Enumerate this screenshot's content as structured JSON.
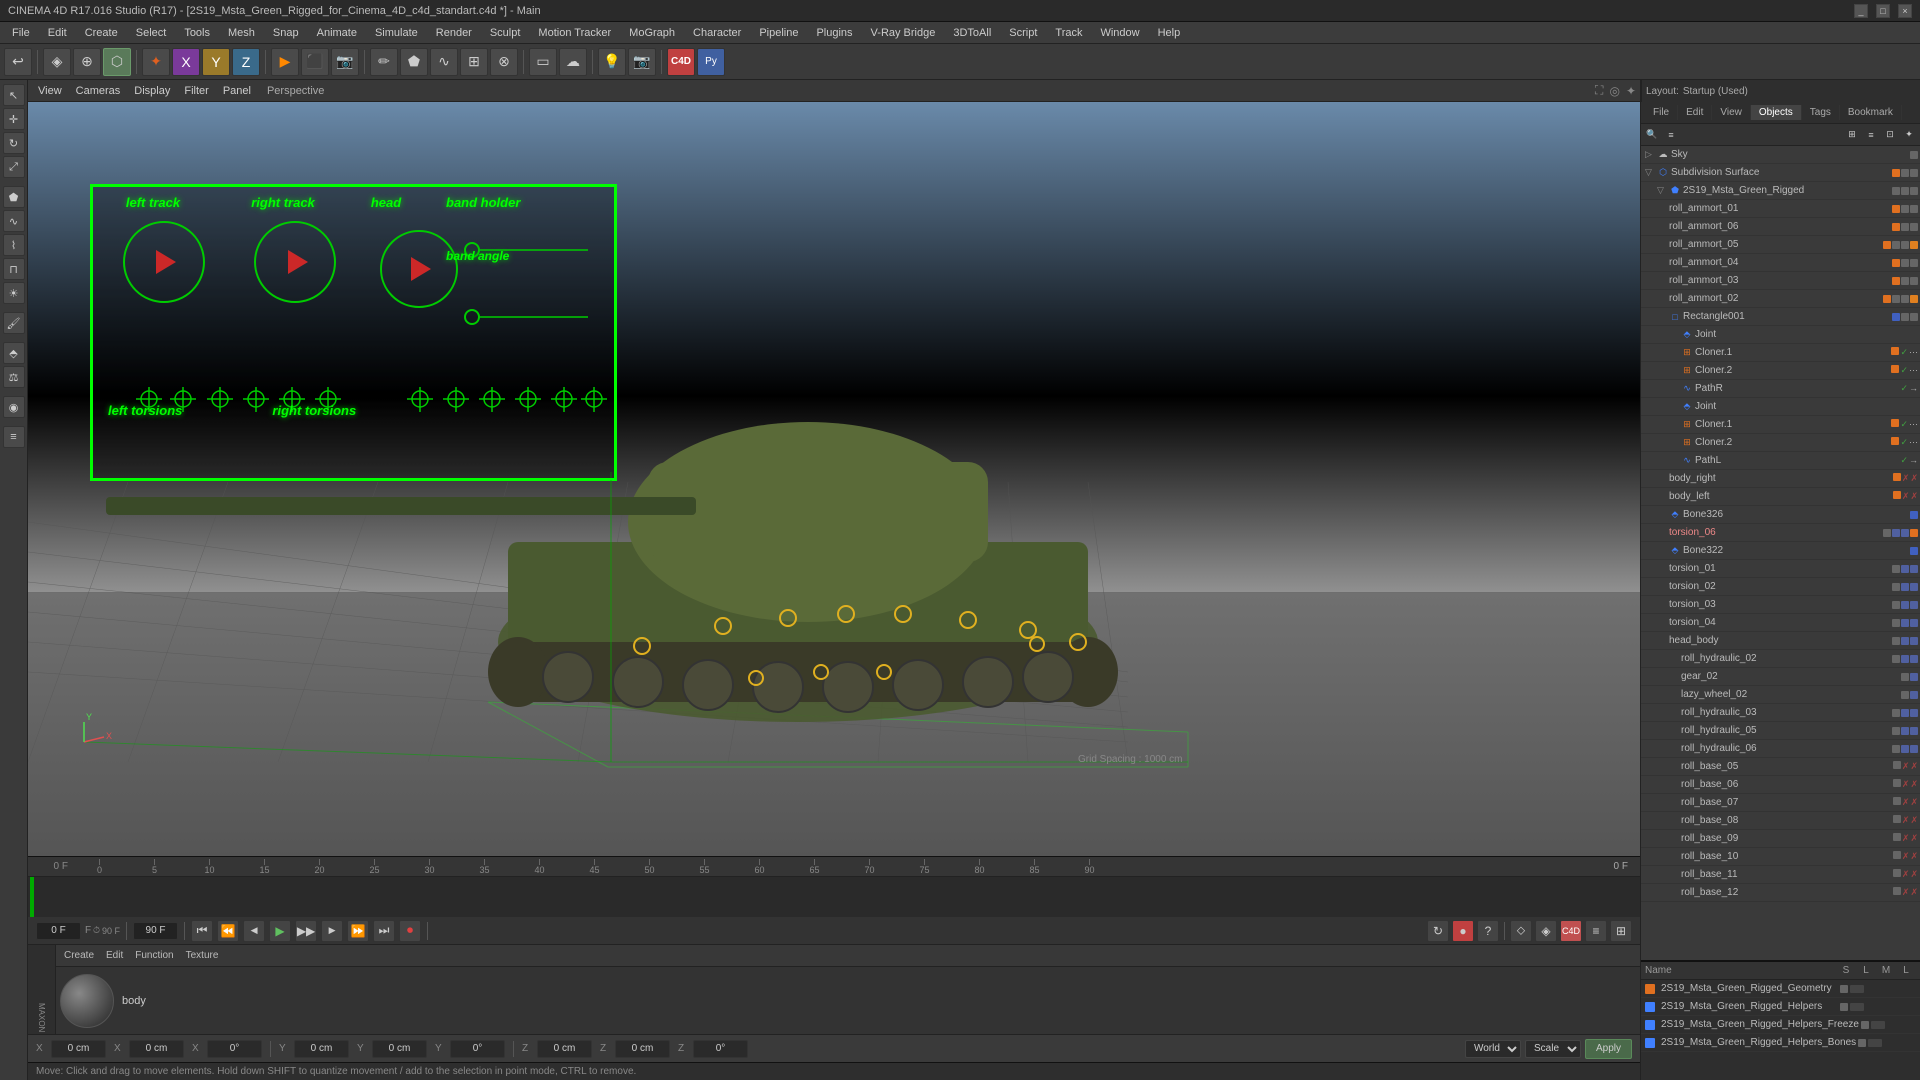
{
  "titlebar": {
    "title": "CINEMA 4D R17.016 Studio (R17) - [2S19_Msta_Green_Rigged_for_Cinema_4D_c4d_standart.c4d *] - Main",
    "controls": [
      "_",
      "□",
      "×"
    ]
  },
  "menubar": {
    "items": [
      "File",
      "Edit",
      "Create",
      "Select",
      "Tools",
      "Mesh",
      "Snap",
      "Animate",
      "Simulate",
      "Render",
      "Sculpt",
      "Motion Tracker",
      "MoGraph",
      "Character",
      "Pipeline",
      "Plugins",
      "V-Ray Bridge",
      "3DToAll",
      "Script",
      "Track",
      "Window",
      "Help"
    ]
  },
  "viewport": {
    "label": "Perspective",
    "view_items": [
      "View",
      "Cameras",
      "Display",
      "Filter",
      "Panel"
    ],
    "grid_spacing": "Grid Spacing : 1000 cm",
    "icons": [
      "⛶",
      "◎",
      "✦"
    ]
  },
  "hud": {
    "track_labels": [
      "left track",
      "right track",
      "head"
    ],
    "slider_labels": [
      "band holder",
      "band angle"
    ],
    "torsion_labels": [
      "left torsions",
      "right torsions"
    ]
  },
  "right_panel": {
    "tabs": [
      "File",
      "Edit",
      "View",
      "Objects",
      "Tags",
      "Bookmark"
    ],
    "layout": "Layout: Startup (Used)",
    "objects": [
      {
        "name": "Sky",
        "indent": 0,
        "icon": "▽",
        "dots": []
      },
      {
        "name": "Subdivision Surface",
        "indent": 0,
        "icon": "▷",
        "dots": [
          "orange",
          "grey",
          "grey"
        ],
        "color": "blue"
      },
      {
        "name": "2S19_Msta_Green_Rigged",
        "indent": 1,
        "icon": "▷",
        "dots": [
          "grey",
          "grey",
          "grey"
        ],
        "expand": true
      },
      {
        "name": "roll_ammort_01",
        "indent": 2,
        "dots": [
          "orange",
          "grey",
          "grey"
        ]
      },
      {
        "name": "roll_ammort_06",
        "indent": 2,
        "dots": [
          "orange",
          "grey",
          "grey"
        ]
      },
      {
        "name": "roll_ammort_05",
        "indent": 2,
        "dots": [
          "orange",
          "grey",
          "grey"
        ]
      },
      {
        "name": "roll_ammort_04",
        "indent": 2,
        "dots": [
          "orange",
          "grey",
          "grey"
        ]
      },
      {
        "name": "roll_ammort_03",
        "indent": 2,
        "dots": [
          "orange",
          "grey",
          "grey"
        ]
      },
      {
        "name": "roll_ammort_02",
        "indent": 2,
        "dots": [
          "orange",
          "grey",
          "grey"
        ]
      },
      {
        "name": "Rectangle001",
        "indent": 2,
        "dots": [
          "blue",
          "grey",
          "grey"
        ]
      },
      {
        "name": "Joint",
        "indent": 3,
        "dots": []
      },
      {
        "name": "Cloner.1",
        "indent": 3,
        "dots": [
          "orange",
          "check",
          "dot3"
        ]
      },
      {
        "name": "Cloner.2",
        "indent": 3,
        "dots": [
          "orange",
          "check",
          "dot3"
        ]
      },
      {
        "name": "PathR",
        "indent": 3,
        "dots": [
          "check",
          "arrow"
        ]
      },
      {
        "name": "Joint",
        "indent": 3,
        "dots": []
      },
      {
        "name": "Cloner.1",
        "indent": 3,
        "dots": [
          "orange",
          "check",
          "dot3"
        ]
      },
      {
        "name": "Cloner.2",
        "indent": 3,
        "dots": [
          "orange",
          "check",
          "dot3"
        ]
      },
      {
        "name": "PathL",
        "indent": 3,
        "dots": [
          "check",
          "arrow"
        ]
      },
      {
        "name": "body_right",
        "indent": 2,
        "dots": [
          "orange",
          "x",
          "x"
        ]
      },
      {
        "name": "body_left",
        "indent": 2,
        "dots": [
          "orange",
          "x",
          "x"
        ]
      },
      {
        "name": "Bone326",
        "indent": 2,
        "dots": [
          "blue",
          "grey"
        ]
      },
      {
        "name": "torsion_06",
        "indent": 2,
        "dots": [
          "grey",
          "dot2",
          "dot2",
          "orange"
        ]
      },
      {
        "name": "Bone322",
        "indent": 2,
        "dots": [
          "blue",
          "grey"
        ]
      },
      {
        "name": "torsion_01",
        "indent": 2,
        "dots": [
          "grey",
          "dot2",
          "dot2"
        ]
      },
      {
        "name": "torsion_02",
        "indent": 2,
        "dots": [
          "grey",
          "dot2",
          "dot2"
        ]
      },
      {
        "name": "torsion_03",
        "indent": 2,
        "dots": [
          "grey",
          "dot2",
          "dot2"
        ]
      },
      {
        "name": "torsion_04",
        "indent": 2,
        "dots": [
          "grey",
          "dot2",
          "dot2"
        ]
      },
      {
        "name": "head_body",
        "indent": 2,
        "dots": [
          "grey",
          "dot2",
          "dot2"
        ]
      },
      {
        "name": "roll_hydraulic_02",
        "indent": 3,
        "dots": [
          "grey",
          "dot2",
          "dot2"
        ]
      },
      {
        "name": "gear_02",
        "indent": 3,
        "dots": [
          "grey",
          "dot2"
        ]
      },
      {
        "name": "lazy_wheel_02",
        "indent": 3,
        "dots": [
          "grey",
          "dot2"
        ]
      },
      {
        "name": "roll_hydraulic_03",
        "indent": 3,
        "dots": [
          "grey",
          "dot2",
          "dot2"
        ]
      },
      {
        "name": "roll_hydraulic_05",
        "indent": 3,
        "dots": [
          "grey",
          "dot2",
          "dot2"
        ]
      },
      {
        "name": "roll_hydraulic_06",
        "indent": 3,
        "dots": [
          "grey",
          "dot2",
          "dot2"
        ]
      },
      {
        "name": "roll_base_05",
        "indent": 3,
        "dots": [
          "grey",
          "x",
          "x"
        ]
      },
      {
        "name": "roll_base_06",
        "indent": 3,
        "dots": [
          "grey",
          "x",
          "x"
        ]
      },
      {
        "name": "roll_base_07",
        "indent": 3,
        "dots": [
          "grey",
          "x",
          "x"
        ]
      },
      {
        "name": "roll_base_08",
        "indent": 3,
        "dots": [
          "grey",
          "x",
          "x"
        ]
      },
      {
        "name": "roll_base_09",
        "indent": 3,
        "dots": [
          "grey",
          "x",
          "x"
        ]
      },
      {
        "name": "roll_base_10",
        "indent": 3,
        "dots": [
          "grey",
          "x",
          "x"
        ]
      },
      {
        "name": "roll_base_11",
        "indent": 3,
        "dots": [
          "grey",
          "x",
          "x"
        ]
      },
      {
        "name": "roll_base_12",
        "indent": 3,
        "dots": [
          "grey",
          "x",
          "x"
        ]
      }
    ]
  },
  "timeline": {
    "markers": [
      "0",
      "5",
      "10",
      "15",
      "20",
      "25",
      "30",
      "35",
      "40",
      "45",
      "50",
      "55",
      "60",
      "65",
      "70",
      "75",
      "80",
      "85",
      "90"
    ],
    "end_frame": "90 F",
    "current_frame": "0 F"
  },
  "transport": {
    "current_frame_display": "0 F",
    "end_frame_display": "90 F",
    "fps_display": "90 F",
    "buttons": [
      "⏮",
      "⏪",
      "◀",
      "▶",
      "▶▶",
      "⏩",
      "⏭",
      "⏺"
    ]
  },
  "coord_bar": {
    "x_pos": "0 cm",
    "y_pos": "0 cm",
    "z_pos": "0 cm",
    "x_size": "0 cm",
    "y_size": "0 cm",
    "z_size": "0 cm",
    "x_rot": "0°",
    "y_rot": "0°",
    "z_rot": "0°",
    "mode": "World",
    "scale_mode": "Scale",
    "apply_label": "Apply"
  },
  "mat_editor": {
    "toolbar": [
      "Create",
      "Edit",
      "Function",
      "Texture"
    ],
    "preview_label": "body",
    "mat_name": "body"
  },
  "status_bar": {
    "text": "Move: Click and drag to move elements. Hold down SHIFT to quantize movement / add to the selection in point mode, CTRL to remove."
  },
  "bottom_panel": {
    "objects_header": [
      "Name",
      "S",
      "L",
      "M",
      "L"
    ],
    "objects": [
      {
        "name": "2S19_Msta_Green_Rigged_Geometry",
        "color": "orange"
      },
      {
        "name": "2S19_Msta_Green_Rigged_Helpers",
        "color": "blue"
      },
      {
        "name": "2S19_Msta_Green_Rigged_Helpers_Freeze",
        "color": "blue"
      },
      {
        "name": "2S19_Msta_Green_Rigged_Helpers_Bones",
        "color": "blue"
      }
    ]
  }
}
